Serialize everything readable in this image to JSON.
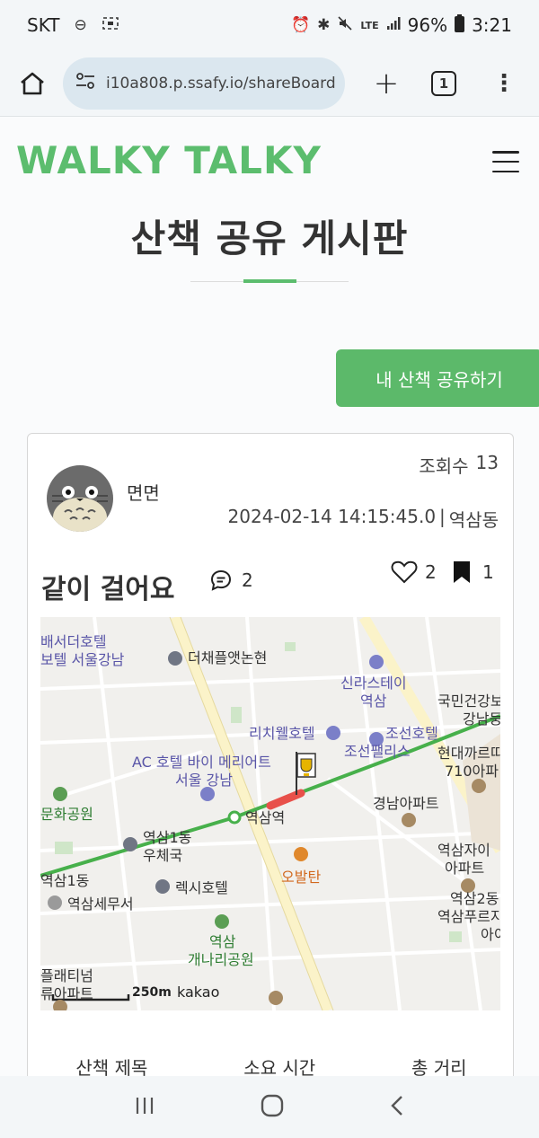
{
  "status_bar": {
    "carrier": "SKT",
    "battery": "96%",
    "time": "3:21",
    "icons": [
      "do-not-disturb-icon",
      "screen-record-icon",
      "alarm-icon",
      "bluetooth-icon",
      "mute-icon",
      "lte-icon",
      "signal-icon",
      "battery-icon"
    ]
  },
  "browser": {
    "url": "i10a808.p.ssafy.io/shareBoard",
    "tab_count": "1"
  },
  "header": {
    "logo": "WALKY TALKY"
  },
  "page": {
    "title": "산책 공유 게시판",
    "share_button": "내 산책 공유하기",
    "accent_color": "#5cbd6e"
  },
  "post": {
    "views_label": "조회수",
    "views": "13",
    "author": "면면",
    "datetime": "2024-02-14 14:15:45.0",
    "separator": "|",
    "location": "역삼동",
    "title": "같이 걸어요",
    "comments": "2",
    "likes": "2",
    "bookmarks": "1",
    "map": {
      "labels": [
        "배서더호텔",
        "보텔 서울강남",
        "더채플앳논현",
        "신라스테이",
        "역삼",
        "국민건강보",
        "강남둥",
        "리치웰호텔",
        "조선호텔",
        "조선팰리스",
        "현대까르띠",
        "710아파",
        "AC 호텔 바이 메리어트",
        "서울 강남",
        "문화공원",
        "역삼역",
        "경남아파트",
        "역삼1동",
        "우체국",
        "역삼1동",
        "역삼자이",
        "아파트",
        "오발탄",
        "렉시호텔",
        "역삼세무서",
        "역삼2동",
        "역삼푸르지",
        "아이",
        "역삼",
        "개나리공원",
        "플래티넘",
        "류아파트"
      ],
      "scale": "250m",
      "provider": "kakao"
    },
    "stats_headers": [
      "산책 제목",
      "소요 시간",
      "총 거리"
    ]
  }
}
